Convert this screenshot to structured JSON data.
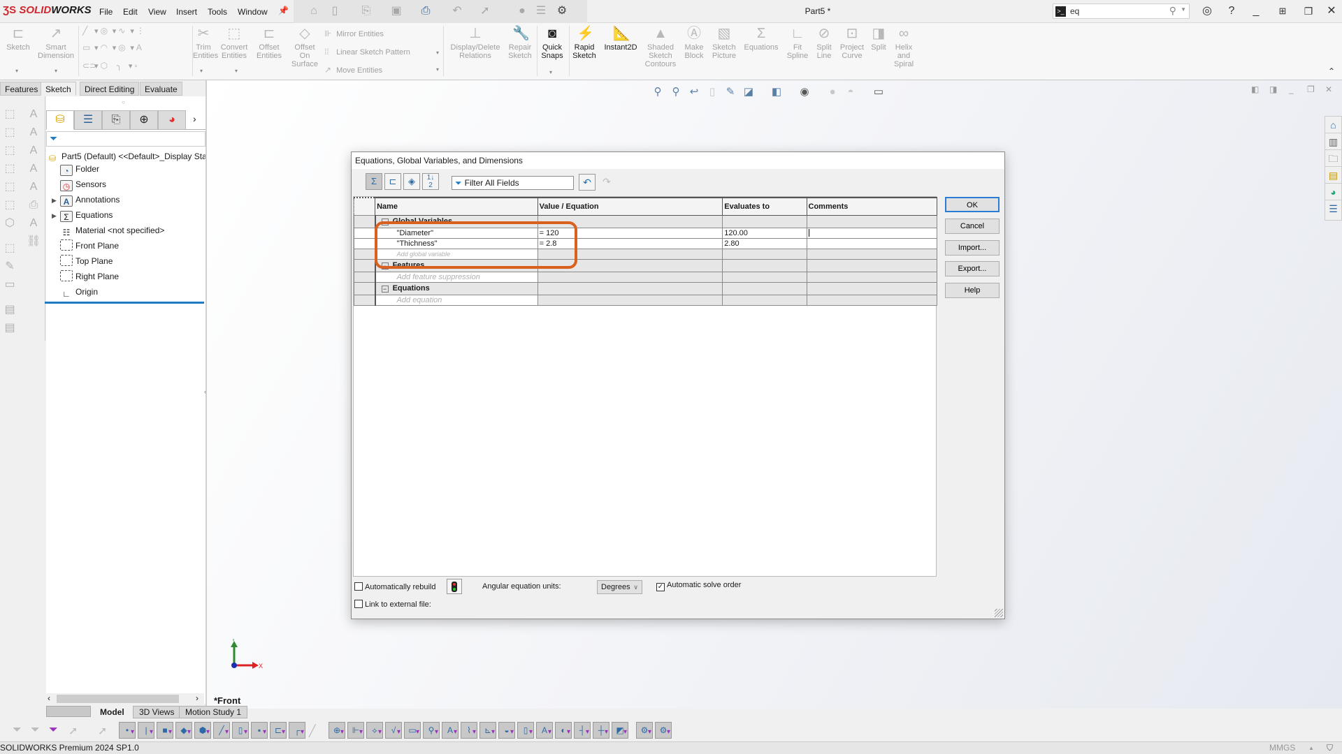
{
  "app": {
    "logo_brand": "SOLID",
    "logo_brand2": "WORKS",
    "document_title": "Part5 *",
    "menu": [
      "File",
      "Edit",
      "View",
      "Insert",
      "Tools",
      "Window"
    ],
    "search": {
      "value": "eq",
      "placeholder": ""
    }
  },
  "ribbon": {
    "sketch": "Sketch",
    "smart_dimension": "Smart Dimension",
    "trim_entities": "Trim Entities",
    "convert_entities": "Convert Entities",
    "offset_entities": "Offset Entities",
    "offset_on_surface": "Offset On Surface",
    "mirror_entities": "Mirror Entities",
    "linear_sketch_pattern": "Linear Sketch Pattern",
    "move_entities": "Move Entities",
    "display_delete_relations": "Display/Delete Relations",
    "repair_sketch": "Repair Sketch",
    "quick_snaps": "Quick Snaps",
    "rapid_sketch": "Rapid Sketch",
    "instant2d": "Instant2D",
    "shaded_sketch_contours": "Shaded Sketch Contours",
    "make_block": "Make Block",
    "sketch_picture": "Sketch Picture",
    "equations": "Equations",
    "fit_spline": "Fit Spline",
    "split_line": "Split Line",
    "project_curve": "Project Curve",
    "split": "Split",
    "helix_and_spiral": "Helix and Spiral"
  },
  "command_tabs": [
    "Features",
    "Sketch",
    "Direct Editing",
    "Evaluate"
  ],
  "active_command_tab": "Sketch",
  "feature_tree": {
    "root": "Part5 (Default) <<Default>_Display Sta",
    "items": [
      {
        "label": "Folder",
        "icon": "folder-icon",
        "expandable": false
      },
      {
        "label": "Sensors",
        "icon": "sensors-icon",
        "expandable": false
      },
      {
        "label": "Annotations",
        "icon": "annotations-icon",
        "expandable": true
      },
      {
        "label": "Equations",
        "icon": "equations-icon",
        "expandable": true
      },
      {
        "label": "Material <not specified>",
        "icon": "material-icon",
        "expandable": false
      },
      {
        "label": "Front Plane",
        "icon": "plane-icon",
        "expandable": false
      },
      {
        "label": "Top Plane",
        "icon": "plane-icon",
        "expandable": false
      },
      {
        "label": "Right Plane",
        "icon": "plane-icon",
        "expandable": false
      },
      {
        "label": "Origin",
        "icon": "origin-icon",
        "expandable": false
      }
    ]
  },
  "viewport": {
    "view_name": "*Front",
    "triad_x": "X",
    "triad_y": "Y"
  },
  "bottom_tabs": [
    "Model",
    "3D Views",
    "Motion Study 1"
  ],
  "active_bottom_tab": "Model",
  "status": {
    "product": "SOLIDWORKS Premium 2024 SP1.0",
    "units": "MMGS"
  },
  "dialog": {
    "title": "Equations, Global Variables, and Dimensions",
    "filter_placeholder": "Filter All Fields",
    "columns": [
      "Name",
      "Value / Equation",
      "Evaluates to",
      "Comments"
    ],
    "groups": [
      {
        "label": "Global Variables",
        "rows": [
          {
            "name": "\"Diameter\"",
            "value": "= 120",
            "evaluates": "120.00",
            "comment": ""
          },
          {
            "name": "\"Thichness\"",
            "value": "= 2.8",
            "evaluates": "2.80",
            "comment": ""
          }
        ],
        "add_placeholder": "Add global variable"
      },
      {
        "label": "Features",
        "rows": [],
        "add_placeholder": "Add feature suppression"
      },
      {
        "label": "Equations",
        "rows": [],
        "add_placeholder": "Add equation"
      }
    ],
    "buttons": {
      "ok": "OK",
      "cancel": "Cancel",
      "import": "Import...",
      "export": "Export...",
      "help": "Help"
    },
    "auto_rebuild": {
      "label": "Automatically rebuild",
      "checked": false
    },
    "angular_units": {
      "label": "Angular equation units:",
      "value": "Degrees"
    },
    "auto_solve": {
      "label": "Automatic solve order",
      "checked": true
    },
    "link_external": {
      "label": "Link to external file:",
      "checked": false
    },
    "highlight_color": "#d9601e"
  }
}
